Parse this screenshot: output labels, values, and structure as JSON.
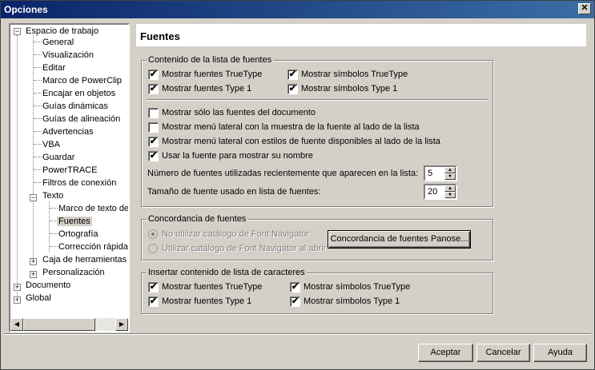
{
  "window": {
    "title": "Opciones",
    "close_glyph": "✕"
  },
  "tree": {
    "items": [
      {
        "label": "Espacio de trabajo",
        "expander": "−"
      },
      {
        "label": "General"
      },
      {
        "label": "Visualización"
      },
      {
        "label": "Editar"
      },
      {
        "label": "Marco de PowerClip"
      },
      {
        "label": "Encajar en objetos"
      },
      {
        "label": "Guías dinámicas"
      },
      {
        "label": "Guías de alineación"
      },
      {
        "label": "Advertencias"
      },
      {
        "label": "VBA"
      },
      {
        "label": "Guardar"
      },
      {
        "label": "PowerTRACE"
      },
      {
        "label": "Filtros de conexión"
      },
      {
        "label": "Texto",
        "expander": "−"
      },
      {
        "label": "Marco de texto de"
      },
      {
        "label": "Fuentes",
        "selected": true
      },
      {
        "label": "Ortografía"
      },
      {
        "label": "Corrección rápida"
      },
      {
        "label": "Caja de herramientas",
        "expander": "+"
      },
      {
        "label": "Personalización",
        "expander": "+"
      },
      {
        "label": "Documento",
        "expander": "+"
      },
      {
        "label": "Global",
        "expander": "+"
      }
    ],
    "scroll_left": "◀",
    "scroll_right": "▶"
  },
  "page": {
    "title": "Fuentes"
  },
  "font_list_group": {
    "legend": "Contenido de la lista de fuentes",
    "cb_truetype": {
      "label": "Mostrar fuentes TrueType",
      "check": "✔"
    },
    "cb_type1": {
      "label": "Mostrar fuentes Type 1",
      "check": "✔"
    },
    "cb_sym_truetype": {
      "label": "Mostrar símbolos TrueType",
      "check": "✔"
    },
    "cb_sym_type1": {
      "label": "Mostrar símbolos Type 1",
      "check": "✔"
    },
    "cb_doc_only": {
      "label": "Mostrar sólo las fuentes del documento",
      "check": ""
    },
    "cb_side_sample": {
      "label": "Mostrar menú lateral con la muestra de la fuente al lado de la lista",
      "check": ""
    },
    "cb_side_styles": {
      "label": "Mostrar menú lateral con estilos de fuente disponibles al lado de la lista",
      "check": "✔"
    },
    "cb_use_font": {
      "label": "Usar la fuente para mostrar su nombre",
      "check": "✔"
    },
    "recent_label": "Número de fuentes utilizadas recientemente que aparecen en la lista:",
    "recent_value": "5",
    "size_label": "Tamaño de fuente usado en lista de fuentes:",
    "size_value": "20",
    "spin_up": "▲",
    "spin_down": "▼"
  },
  "matching_group": {
    "legend": "Concordancia de fuentes",
    "radio_no_catalog": "No utilizar catálogo de Font Navigator",
    "radio_use_catalog": "Utilizar catálogo de Font Navigator al abrir",
    "panose_button": "Concordancia de fuentes Panose..."
  },
  "char_list_group": {
    "legend": "Insertar contenido de lista de caracteres",
    "cb_truetype": {
      "label": "Mostrar fuentes TrueType",
      "check": "✔"
    },
    "cb_type1": {
      "label": "Mostrar fuentes Type 1",
      "check": "✔"
    },
    "cb_sym_truetype": {
      "label": "Mostrar símbolos TrueType",
      "check": "✔"
    },
    "cb_sym_type1": {
      "label": "Mostrar símbolos Type 1",
      "check": "✔"
    }
  },
  "buttons": {
    "ok": "Aceptar",
    "cancel": "Cancelar",
    "help": "Ayuda"
  }
}
